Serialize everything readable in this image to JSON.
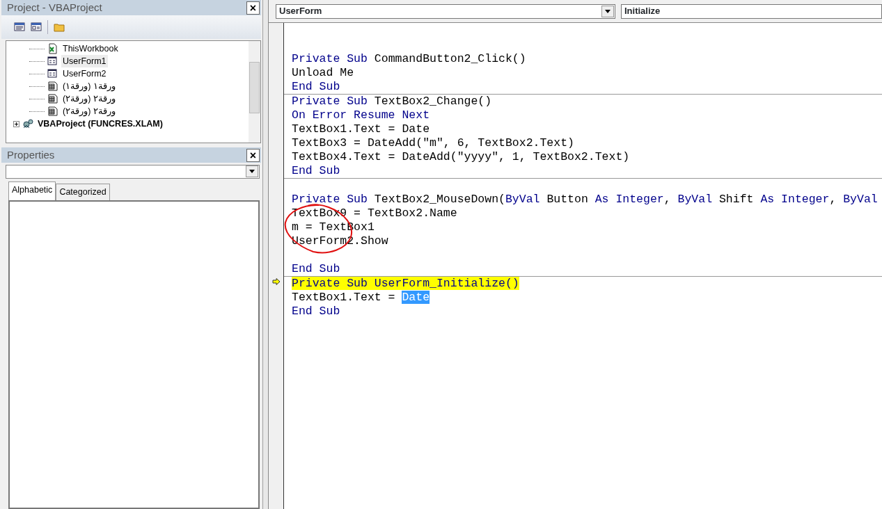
{
  "project_panel": {
    "title": "Project - VBAProject",
    "close": "×",
    "toolbar": [
      {
        "kind": "view-code"
      },
      {
        "kind": "view-object"
      },
      {
        "kind": "folder"
      }
    ],
    "tree": [
      {
        "label": "ThisWorkbook",
        "kind": "workbook",
        "selected": false,
        "bold": false
      },
      {
        "label": "UserForm1",
        "kind": "form",
        "selected": true,
        "bold": false
      },
      {
        "label": "UserForm2",
        "kind": "form",
        "selected": false,
        "bold": false
      },
      {
        "label": "ورقة١ (ورقة١)",
        "kind": "sheet",
        "selected": false,
        "bold": false
      },
      {
        "label": "ورقة٢ (ورقة٢)",
        "kind": "sheet",
        "selected": false,
        "bold": false
      },
      {
        "label": "ورقة٢ (ورقة٢)",
        "kind": "sheet",
        "selected": false,
        "bold": false
      },
      {
        "label": "VBAProject (FUNCRES.XLAM)",
        "kind": "project",
        "selected": false,
        "bold": true,
        "expanded": false
      }
    ]
  },
  "properties_panel": {
    "title": "Properties",
    "close": "×",
    "tabs": [
      {
        "label": "Alphabetic",
        "selected": true
      },
      {
        "label": "Categorized",
        "selected": false
      }
    ]
  },
  "code_window": {
    "object_combo": "UserForm",
    "procedure_combo": "Initialize",
    "procedures": [
      {
        "lines": [
          {
            "kind": "blank"
          },
          {
            "kind": "blank"
          },
          {
            "kind": "code",
            "current": false,
            "segments": [
              {
                "text": "Private Sub ",
                "kind": "kw"
              },
              {
                "text": "CommandButton2_Click()",
                "kind": "plain"
              }
            ]
          },
          {
            "kind": "code",
            "current": false,
            "segments": [
              {
                "text": "Unload Me",
                "kind": "plain"
              }
            ]
          },
          {
            "kind": "code",
            "current": false,
            "segments": [
              {
                "text": "End Sub",
                "kind": "kw"
              }
            ]
          }
        ]
      },
      {
        "lines": [
          {
            "kind": "code",
            "current": false,
            "segments": [
              {
                "text": "Private Sub ",
                "kind": "kw"
              },
              {
                "text": "TextBox2_Change()",
                "kind": "plain"
              }
            ]
          },
          {
            "kind": "code",
            "current": false,
            "segments": [
              {
                "text": "On Error Resume Next",
                "kind": "kw"
              }
            ]
          },
          {
            "kind": "code",
            "current": false,
            "segments": [
              {
                "text": "TextBox1.Text = Date",
                "kind": "plain"
              }
            ]
          },
          {
            "kind": "code",
            "current": false,
            "segments": [
              {
                "text": "TextBox3 = DateAdd(\"m\", 6, TextBox2.Text)",
                "kind": "plain"
              }
            ]
          },
          {
            "kind": "code",
            "current": false,
            "segments": [
              {
                "text": "TextBox4.Text = DateAdd(\"yyyy\", 1, TextBox2.Text)",
                "kind": "plain"
              }
            ]
          },
          {
            "kind": "code",
            "current": false,
            "segments": [
              {
                "text": "End Sub",
                "kind": "kw"
              }
            ]
          }
        ]
      },
      {
        "lines": [
          {
            "kind": "blank"
          },
          {
            "kind": "code",
            "current": false,
            "segments": [
              {
                "text": "Private Sub ",
                "kind": "kw"
              },
              {
                "text": "TextBox2_MouseDown(",
                "kind": "plain"
              },
              {
                "text": "ByVal",
                "kind": "kw"
              },
              {
                "text": " Button ",
                "kind": "plain"
              },
              {
                "text": "As Integer",
                "kind": "kw"
              },
              {
                "text": ", ",
                "kind": "plain"
              },
              {
                "text": "ByVal",
                "kind": "kw"
              },
              {
                "text": " Shift ",
                "kind": "plain"
              },
              {
                "text": "As Integer",
                "kind": "kw"
              },
              {
                "text": ", ",
                "kind": "plain"
              },
              {
                "text": "ByVal",
                "kind": "kw"
              }
            ]
          },
          {
            "kind": "code",
            "current": false,
            "segments": [
              {
                "text": "TextBox9 = TextBox2.Name",
                "kind": "plain"
              }
            ]
          },
          {
            "kind": "code",
            "current": false,
            "segments": [
              {
                "text": "m = TextBox1",
                "kind": "plain"
              }
            ]
          },
          {
            "kind": "code",
            "current": false,
            "segments": [
              {
                "text": "UserForm2.Show",
                "kind": "plain"
              }
            ]
          },
          {
            "kind": "blank"
          },
          {
            "kind": "code",
            "current": false,
            "segments": [
              {
                "text": "End Sub",
                "kind": "kw"
              }
            ]
          }
        ]
      },
      {
        "lines": [
          {
            "kind": "code",
            "current": true,
            "segments": [
              {
                "text": "Private Sub UserForm_Initialize()",
                "kind": "exec"
              }
            ]
          },
          {
            "kind": "code",
            "current": false,
            "segments": [
              {
                "text": "TextBox1.Text = ",
                "kind": "plain"
              },
              {
                "text": "Date",
                "kind": "sel"
              }
            ]
          },
          {
            "kind": "code",
            "current": false,
            "segments": [
              {
                "text": "End Sub",
                "kind": "kw"
              }
            ]
          }
        ]
      }
    ]
  },
  "annotations": [
    {
      "kind": "freehand-circle",
      "color": "#e01010"
    }
  ]
}
